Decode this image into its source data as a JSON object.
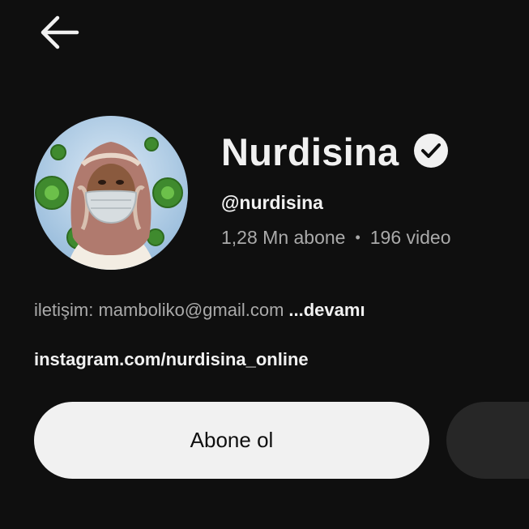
{
  "header": {
    "back_icon": "arrow-left-icon"
  },
  "channel": {
    "name": "Nurdisina",
    "verified_icon": "verified-check-icon",
    "handle": "@nurdisina",
    "subscribers": "1,28 Mn abone",
    "separator": "•",
    "videos": "196 video",
    "avatar_icon": "channel-avatar"
  },
  "description": {
    "text": "iletişim: mamboliko@gmail.com",
    "more_label": "...devamı"
  },
  "link": {
    "text": "instagram.com/nurdisina_online"
  },
  "actions": {
    "subscribe_label": "Abone ol"
  },
  "colors": {
    "background": "#0f0f0f",
    "primary_text": "#f1f1f1",
    "secondary_text": "#aaaaaa",
    "button_light": "#f1f1f1",
    "button_dark": "#272727"
  }
}
